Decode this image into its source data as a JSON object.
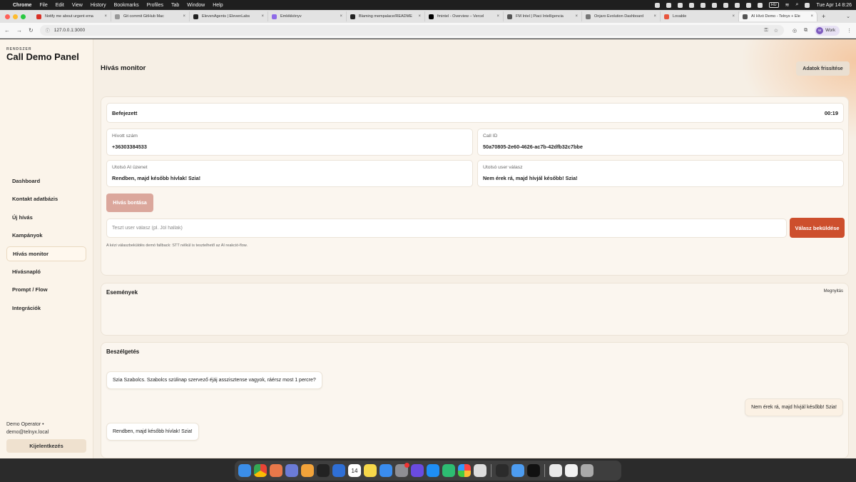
{
  "menubar": {
    "app": "Chrome",
    "items": [
      "File",
      "Edit",
      "View",
      "History",
      "Bookmarks",
      "Profiles",
      "Tab",
      "Window",
      "Help"
    ],
    "keyboard": "HU",
    "clock": "Tue Apr 14  8:26"
  },
  "tabs": [
    {
      "label": "Notify me about urgent ema",
      "color": "#d93025"
    },
    {
      "label": "Git commit GitHub Mac",
      "color": "#999999"
    },
    {
      "label": "ElevenAgents | ElevenLabs",
      "color": "#222222"
    },
    {
      "label": "Emlékkönyv",
      "color": "#8e6be8"
    },
    {
      "label": "Blaming mempalace/README",
      "color": "#222222"
    },
    {
      "label": "fmintel - Overview – Vercel",
      "color": "#000000"
    },
    {
      "label": "FM Intel | Piaci Intelligencia",
      "color": "#555555"
    },
    {
      "label": "Onjaro Evolution Dashboard",
      "color": "#777777"
    },
    {
      "label": "Lovable",
      "color": "#e8553d"
    },
    {
      "label": "AI Hívó Demo - Telnyx + Ele",
      "color": "#555555"
    }
  ],
  "browser": {
    "url": "127.0.0.1:3000",
    "profile_label": "Work"
  },
  "sidebar": {
    "kicker": "RENDSZER",
    "title": "Call Demo Panel",
    "items": [
      {
        "label": "Dashboard"
      },
      {
        "label": "Kontakt adatbázis"
      },
      {
        "label": "Új hívás"
      },
      {
        "label": "Kampányok"
      },
      {
        "label": "Hívás monitor"
      },
      {
        "label": "Hívásnapló"
      },
      {
        "label": "Prompt / Flow"
      },
      {
        "label": "Integrációk"
      }
    ],
    "operator_name": "Demo Operator  •",
    "operator_email": "demo@telnyx.local",
    "logout_label": "Kijelentkezés"
  },
  "main": {
    "title": "Hívás monitor",
    "refresh_label": "Adatok frissítése",
    "status": "Befejezett",
    "duration": "00:19",
    "fields": {
      "called_number_label": "Hívott szám",
      "called_number": "+36303384533",
      "call_id_label": "Call ID",
      "call_id": "50a70805-2e60-4626-ac7b-42dfb32c7bbe",
      "last_ai_label": "Utolsó AI üzenet",
      "last_ai": "Rendben, majd később hívlak! Szia!",
      "last_user_label": "Utolsó user válasz",
      "last_user": "Nem érek rá, majd hívjál később! Szia!"
    },
    "hangup_label": "Hívás bontása",
    "reply_placeholder": "Teszt user válasz (pl. Jól hallak)",
    "send_label": "Válasz beküldése",
    "hint": "A kézi válaszbeküldés demó fallback: STT nélkül is tesztelhető az AI reakció-flow.",
    "events_title": "Események",
    "events_open": "Megnyitás",
    "conversation_title": "Beszélgetés",
    "messages": [
      {
        "role": "ai",
        "text": "Szia Szabolcs. Szabolcs szülinap szervező éjáj asszisztense vagyok, ráérsz most 1 percre?"
      },
      {
        "role": "user",
        "text": "Nem érek rá, majd hívjál később! Szia!"
      },
      {
        "role": "ai",
        "text": "Rendben, majd később hívlak! Szia!"
      }
    ]
  },
  "colors": {
    "accent": "#cd4f2d",
    "hangup": "#dba79c",
    "background": "#f6efe5"
  },
  "dock": {
    "calendar_day": "14"
  }
}
